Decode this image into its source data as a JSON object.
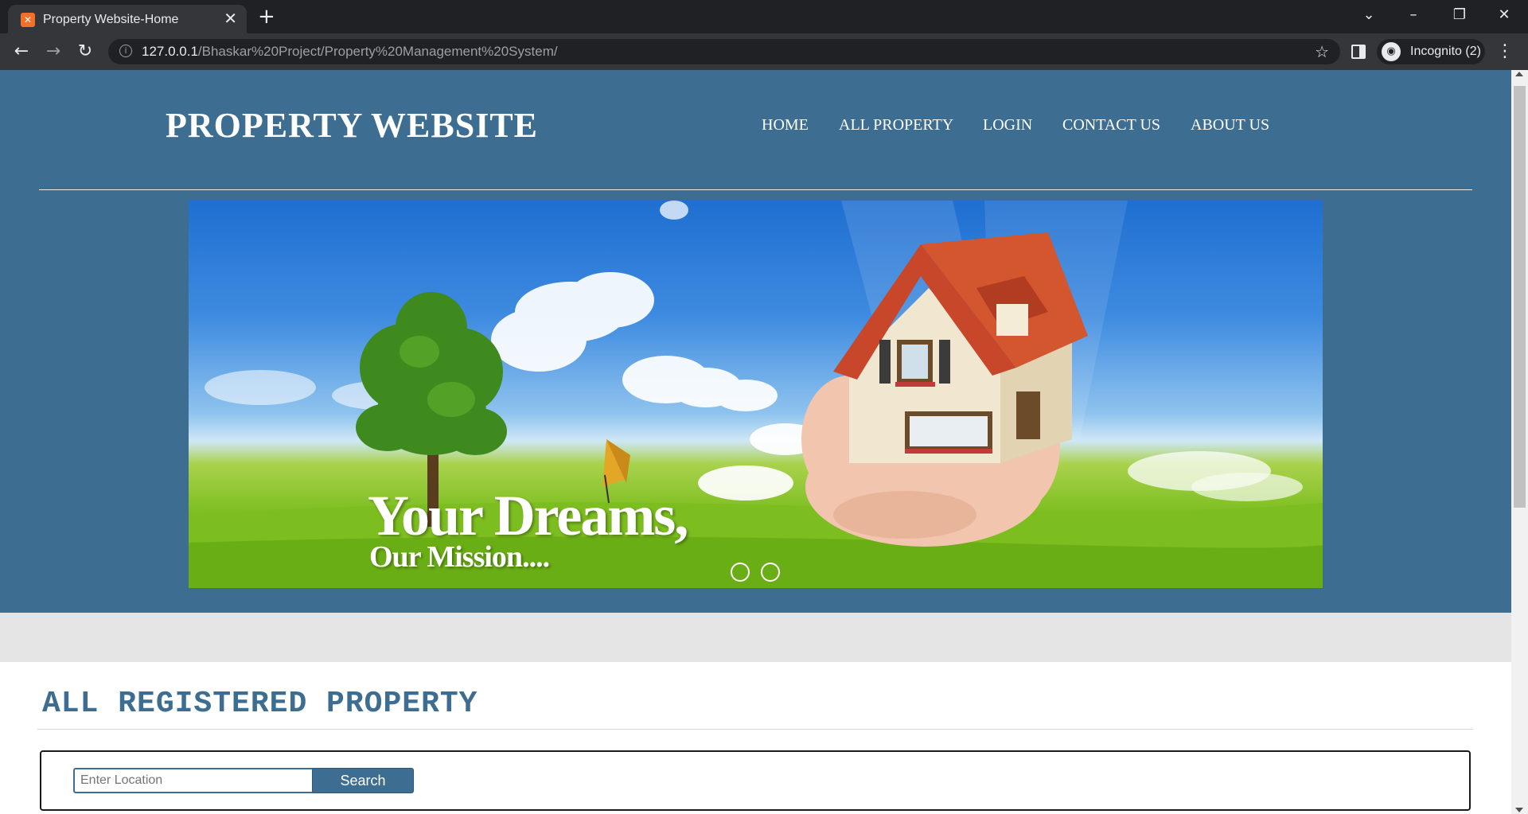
{
  "browser": {
    "tab_title": "Property Website-Home",
    "tab_close": "✕",
    "new_tab": "+",
    "url_host": "127.0.0.1",
    "url_path": "/Bhaskar%20Project/Property%20Management%20System/",
    "incognito_label": "Incognito (2)",
    "icons": [
      "xampp-favicon",
      "back-icon",
      "forward-icon",
      "reload-icon",
      "info-icon",
      "star-icon",
      "side-panel-icon",
      "incognito-icon",
      "menu-icon",
      "tab-search-icon",
      "minimize-icon",
      "restore-icon",
      "close-icon"
    ]
  },
  "site": {
    "title": "PROPERTY WEBSITE",
    "nav": [
      {
        "label": "HOME"
      },
      {
        "label": "ALL PROPERTY"
      },
      {
        "label": "LOGIN"
      },
      {
        "label": "CONTACT US"
      },
      {
        "label": "ABOUT US"
      }
    ],
    "banner": {
      "headline": "Your Dreams,",
      "subline": "Our Mission....",
      "slide_count": 2
    },
    "colors": {
      "primary": "#3d6d90",
      "band": "#e5e5e5"
    }
  },
  "main": {
    "section_title": "ALL REGISTERED PROPERTY",
    "search": {
      "placeholder": "Enter Location",
      "value": "",
      "button_label": "Search"
    }
  }
}
